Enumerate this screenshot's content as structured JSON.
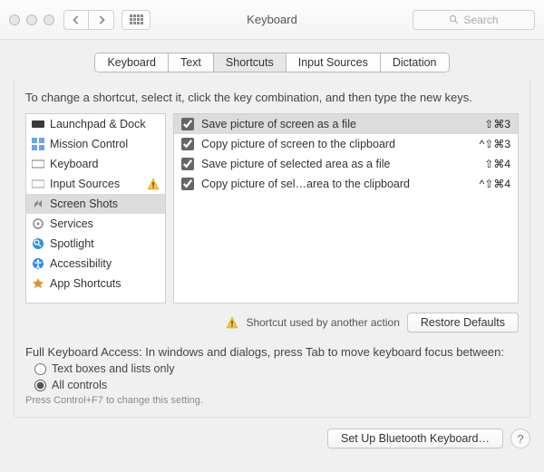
{
  "window": {
    "title": "Keyboard"
  },
  "search": {
    "placeholder": "Search"
  },
  "tabs": {
    "items": [
      {
        "label": "Keyboard"
      },
      {
        "label": "Text"
      },
      {
        "label": "Shortcuts"
      },
      {
        "label": "Input Sources"
      },
      {
        "label": "Dictation"
      }
    ],
    "active_index": 2
  },
  "instruction": "To change a shortcut, select it, click the key combination, and then type the new keys.",
  "categories": [
    {
      "label": "Launchpad & Dock",
      "icon": "launchpad"
    },
    {
      "label": "Mission Control",
      "icon": "mission-control"
    },
    {
      "label": "Keyboard",
      "icon": "keyboard"
    },
    {
      "label": "Input Sources",
      "icon": "input-sources",
      "warning": true
    },
    {
      "label": "Screen Shots",
      "icon": "screenshots",
      "selected": true
    },
    {
      "label": "Services",
      "icon": "services"
    },
    {
      "label": "Spotlight",
      "icon": "spotlight"
    },
    {
      "label": "Accessibility",
      "icon": "accessibility"
    },
    {
      "label": "App Shortcuts",
      "icon": "app-shortcuts"
    }
  ],
  "shortcuts": [
    {
      "checked": true,
      "label": "Save picture of screen as a file",
      "keys": "⇧⌘3",
      "selected": true
    },
    {
      "checked": true,
      "label": "Copy picture of screen to the clipboard",
      "keys": "^⇧⌘3"
    },
    {
      "checked": true,
      "label": "Save picture of selected area as a file",
      "keys": "⇧⌘4"
    },
    {
      "checked": true,
      "label": "Copy picture of sel…area to the clipboard",
      "keys": "^⇧⌘4"
    }
  ],
  "conflict_legend": "Shortcut used by another action",
  "restore_button": "Restore Defaults",
  "fka": {
    "heading": "Full Keyboard Access: In windows and dialogs, press Tab to move keyboard focus between:",
    "options": [
      {
        "label": "Text boxes and lists only",
        "checked": false
      },
      {
        "label": "All controls",
        "checked": true
      }
    ],
    "hint": "Press Control+F7 to change this setting."
  },
  "footer": {
    "bluetooth_button": "Set Up Bluetooth Keyboard…"
  }
}
